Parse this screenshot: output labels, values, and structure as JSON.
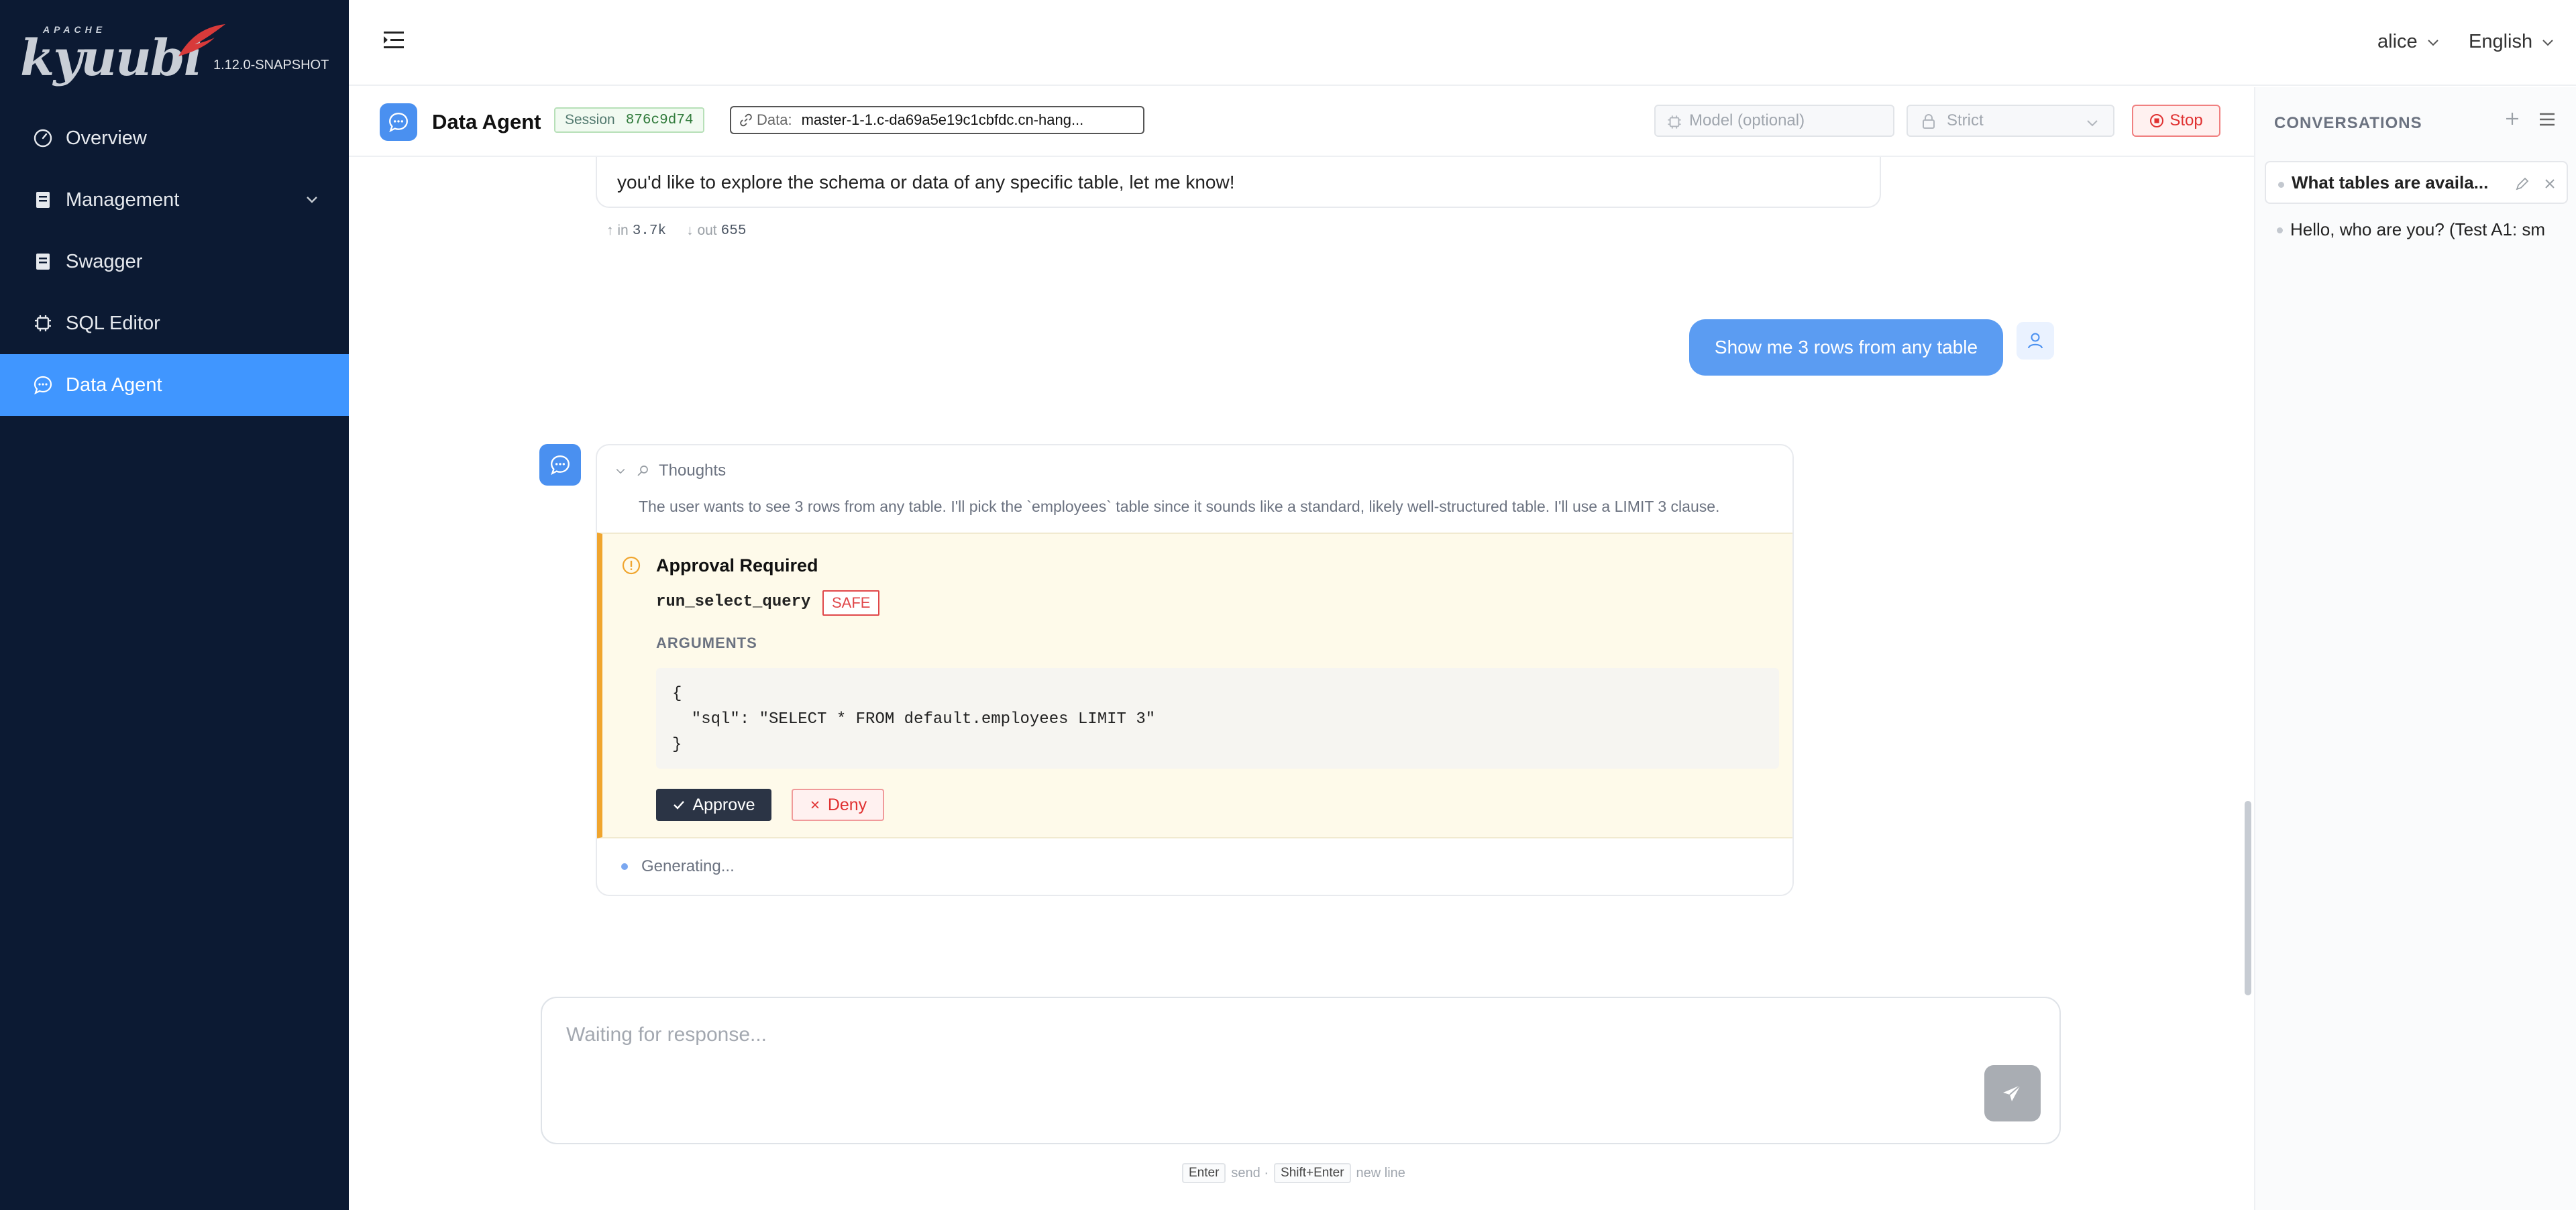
{
  "app": {
    "logo_small": "APACHE",
    "logo_text": "kyuubi",
    "version": "1.12.0-SNAPSHOT"
  },
  "sidebar": {
    "items": [
      {
        "label": "Overview",
        "icon": "dashboard-icon"
      },
      {
        "label": "Management",
        "icon": "document-icon",
        "expandable": true
      },
      {
        "label": "Swagger",
        "icon": "document-icon"
      },
      {
        "label": "SQL Editor",
        "icon": "chip-icon"
      },
      {
        "label": "Data Agent",
        "icon": "chat-icon",
        "active": true
      }
    ]
  },
  "topbar": {
    "user": "alice",
    "language": "English"
  },
  "agent_header": {
    "title": "Data Agent",
    "session_label": "Session",
    "session_id": "876c9d74",
    "data_label": "Data:",
    "data_value": "master-1-1.c-da69a5e19c1cbfdc.cn-hang...",
    "model_placeholder": "Model (optional)",
    "mode": "Strict",
    "stop_label": "Stop"
  },
  "conversations": {
    "title": "CONVERSATIONS",
    "items": [
      {
        "label": "What tables are availa...",
        "active": true
      },
      {
        "label": "Hello, who are you? (Test A1: sm",
        "active": false
      }
    ]
  },
  "chat": {
    "previous_reply_tail": "you'd like to explore the schema or data of any specific table, let me know!",
    "tokens": {
      "in_label": "↑ in",
      "in": "3.7k",
      "out_label": "↓ out",
      "out": "655"
    },
    "user_message": "Show me 3 rows from any table",
    "thoughts_label": "Thoughts",
    "thoughts_text": "The user wants to see 3 rows from any table. I'll pick the `employees` table since it sounds like a standard, likely well-structured table. I'll use a LIMIT 3 clause.",
    "approval": {
      "title": "Approval Required",
      "tool": "run_select_query",
      "safety": "SAFE",
      "args_label": "ARGUMENTS",
      "args": "{\n  \"sql\": \"SELECT * FROM default.employees LIMIT 3\"\n}",
      "approve_label": "Approve",
      "deny_label": "Deny"
    },
    "status": "Generating..."
  },
  "composer": {
    "placeholder": "Waiting for response...",
    "hint_enter": "Enter",
    "hint_send": "send ·",
    "hint_shift": "Shift+Enter",
    "hint_newline": "new line"
  },
  "colors": {
    "sidebar_bg": "#0c1a33",
    "accent": "#4096ff",
    "user_bubble": "#5b9cf2",
    "warning": "#f0a52e",
    "danger": "#e03131"
  }
}
